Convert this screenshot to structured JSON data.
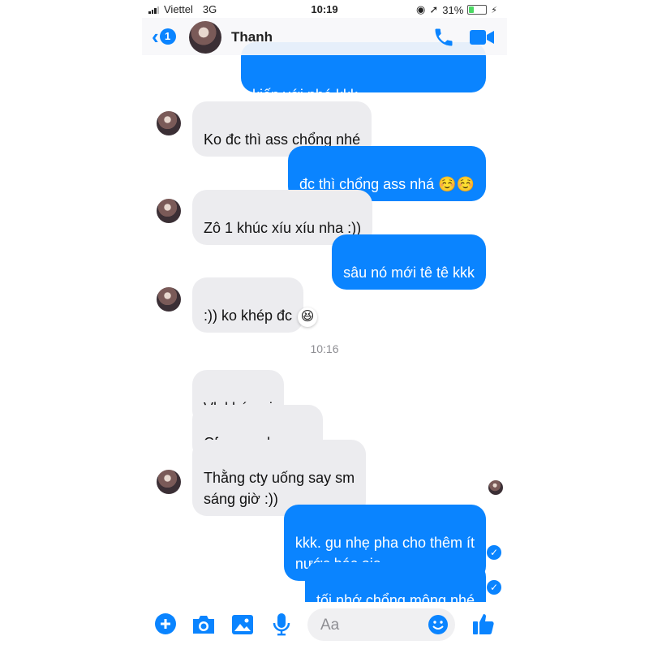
{
  "status_bar": {
    "carrier": "Viettel",
    "network": "3G",
    "time": "10:19",
    "battery": "31%",
    "battery_level": 0.31
  },
  "header": {
    "contact_name": "Thanh",
    "back_badge": "1"
  },
  "messages": [
    {
      "text": "kiến với nhé kkk",
      "partial_top": true
    },
    {
      "text": "Ko đc thì ass chổng nhé"
    },
    {
      "text": "đc thì chổng ass nhá ☺️☺️"
    },
    {
      "text": "Zô 1 khúc xíu xíu nha :))"
    },
    {
      "text": "sâu nó mới tê tê kkk"
    },
    {
      "text": ":)) ko khép đc",
      "reaction": "😆"
    },
    {
      "text": "Vlol bác ơi"
    },
    {
      "text": "Cf ngon như nyc"
    },
    {
      "text": "Thằng cty uống say sm\nsáng giờ :))"
    },
    {
      "text": "kkk. gu nhẹ pha cho thêm ít\nnước bác oie"
    },
    {
      "text": "tối nhớ chổng mông nhé"
    }
  ],
  "timestamp": "10:16",
  "composer": {
    "placeholder": "Aa"
  },
  "colors": {
    "accent": "#0a84ff",
    "incoming_bubble": "#ececef",
    "outgoing_bubble": "#0a84ff"
  },
  "icons": [
    "back-chevron-icon",
    "phone-icon",
    "video-camera-icon",
    "plus-icon",
    "camera-icon",
    "image-icon",
    "microphone-icon",
    "emoji-icon",
    "thumbs-up-icon"
  ]
}
